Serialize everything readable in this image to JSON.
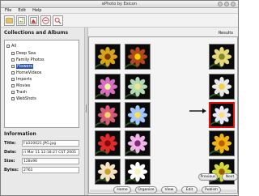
{
  "window": {
    "title": "ePhoto by Exicon"
  },
  "menu": [
    "File",
    "Edit",
    "Help"
  ],
  "toolbar": {
    "buttons": [
      "new-collection-icon",
      "photo-icon",
      "import-icon",
      "webshot-icon",
      "search-icon"
    ]
  },
  "collections": {
    "title": "Collections and Albums",
    "items": [
      {
        "label": "All",
        "selected": false
      },
      {
        "label": "Deep Sea",
        "selected": false
      },
      {
        "label": "Family Photos",
        "selected": false
      },
      {
        "label": "Flowers",
        "selected": true
      },
      {
        "label": "HomeVideos",
        "selected": false
      },
      {
        "label": "Imports",
        "selected": false
      },
      {
        "label": "Movies",
        "selected": false
      },
      {
        "label": "Trash",
        "selected": false
      },
      {
        "label": "WebShots",
        "selected": false
      }
    ]
  },
  "information": {
    "title": "Information",
    "fields": [
      {
        "key": "Title:",
        "value": "FLO20021.JPG.jpg"
      },
      {
        "key": "Date:",
        "value": "ri Mar 11 12:18:27 CST 2005"
      },
      {
        "key": "Size:",
        "value": "128x96"
      },
      {
        "key": "Bytes:",
        "value": "2761"
      }
    ]
  },
  "results": {
    "label": "Results",
    "thumbnails": [
      {
        "color": "#d8a21a",
        "center": "#7a3d00"
      },
      {
        "color": "#b04a18",
        "center": "#f0d000"
      },
      {
        "color": "#e6d77a",
        "center": "#7d8a2a"
      },
      {
        "color": "#d86ec0",
        "center": "#f3f3a0"
      },
      {
        "color": "#b3d9b5",
        "center": "#f0e58a"
      },
      {
        "color": "#e9e9e9",
        "center": "#f7d13b"
      },
      {
        "color": "#d85b7a",
        "center": "#f2d36b"
      },
      {
        "color": "#a2c6ff",
        "center": "#ffe04a"
      },
      {
        "color": "#eaeaff",
        "center": "#ffe16a"
      },
      {
        "color": "#e22a2a",
        "center": "#7a1010"
      },
      {
        "color": "#f1b4e8",
        "center": "#7a2d70"
      },
      {
        "color": "#f0b316",
        "center": "#b85e00"
      },
      {
        "color": "#f2e2c3",
        "center": "#c99e2a"
      },
      {
        "color": "#ffffff",
        "center": "#f8f4b6"
      },
      {
        "color": "#d4d93b",
        "center": "#a05a0c"
      }
    ],
    "selected_index": 8
  },
  "pager": {
    "previous": "Previous",
    "next": "Next"
  },
  "actions": [
    "Home",
    "Organize",
    "View",
    "Edit",
    "Publish"
  ]
}
